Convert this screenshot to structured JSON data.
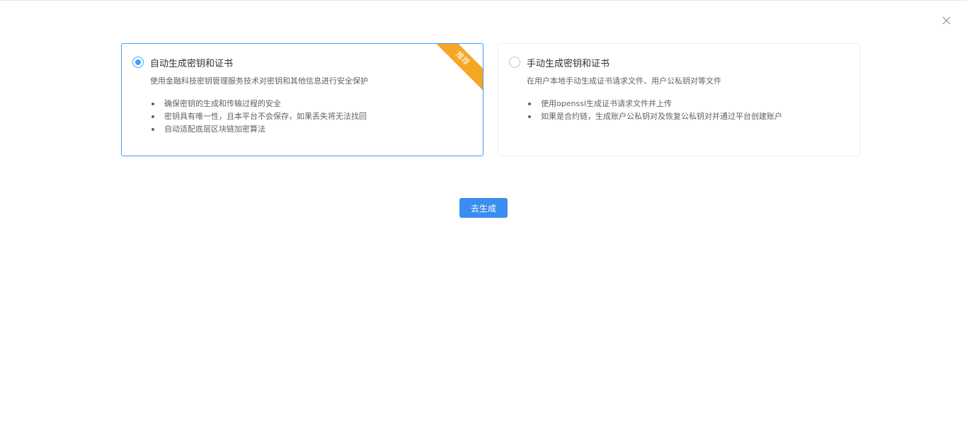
{
  "dialog": {
    "close_icon": "close-icon"
  },
  "options": {
    "auto": {
      "title": "自动生成密钥和证书",
      "description": "使用金融科技密钥管理服务技术对密钥和其他信息进行安全保护",
      "badge": "推荐",
      "selected": true,
      "bullets": [
        "确保密钥的生成和传输过程的安全",
        "密钥具有唯一性，且本平台不会保存，如果丢失将无法找回",
        "自动适配底层区块链加密算法"
      ]
    },
    "manual": {
      "title": "手动生成密钥和证书",
      "description": "在用户本地手动生成证书请求文件、用户公私钥对等文件",
      "selected": false,
      "bullets": [
        "使用openssl生成证书请求文件并上传",
        "如果是合约链，生成账户公私钥对及恢复公私钥对并通过平台创建账户"
      ]
    }
  },
  "actions": {
    "generate_label": "去生成"
  },
  "colors": {
    "primary": "#409eff",
    "button": "#3c8cf0",
    "badge": "#f5a623"
  }
}
